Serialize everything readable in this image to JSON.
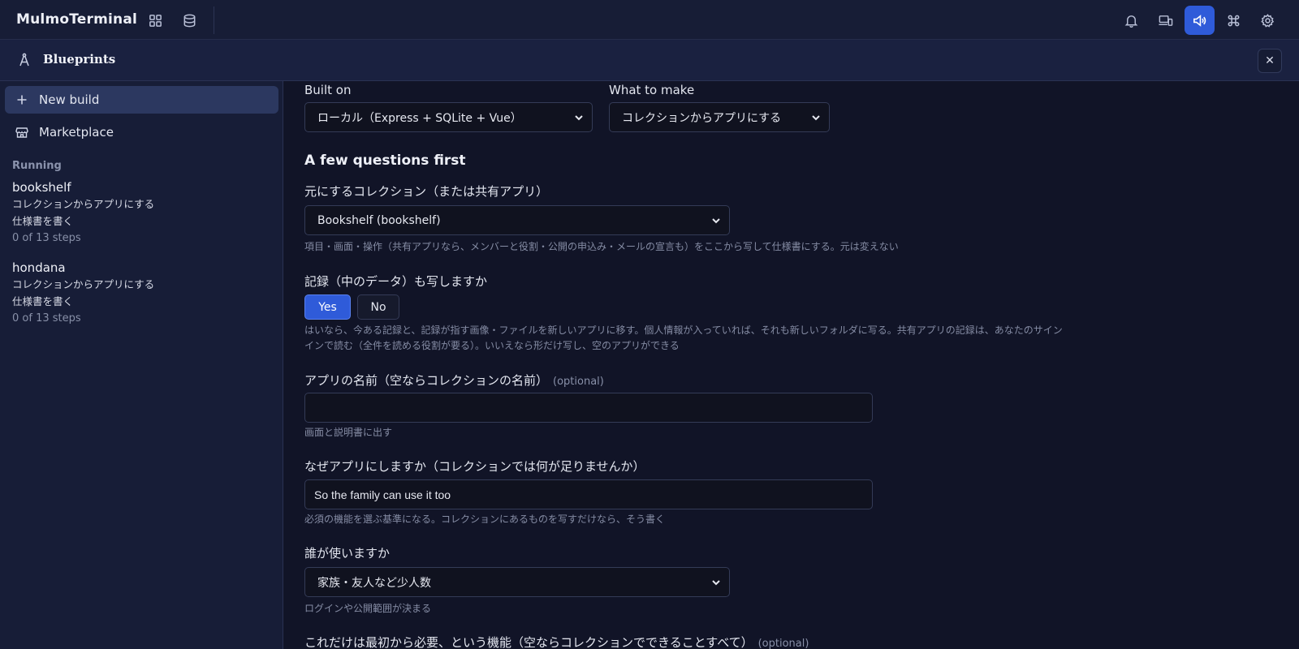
{
  "app": {
    "title": "MulmoTerminal"
  },
  "topbar": {
    "left_icons": [
      "grid-icon",
      "database-icon"
    ],
    "right_icons": [
      "bell-icon",
      "devices-icon",
      "speaker-icon",
      "command-icon",
      "gear-icon"
    ],
    "active_icon": "speaker-icon",
    "accent": "#2f5bd9"
  },
  "subheader": {
    "title": "Blueprints",
    "icon": "compass-icon",
    "close_icon": "close-icon"
  },
  "sidebar": {
    "new_build": "New build",
    "marketplace": "Marketplace",
    "running_label": "Running",
    "running": [
      {
        "name": "bookshelf",
        "kind": "コレクションからアプリにする",
        "step": "仕様書を書く",
        "progress": "0 of 13 steps"
      },
      {
        "name": "hondana",
        "kind": "コレクションからアプリにする",
        "step": "仕様書を書く",
        "progress": "0 of 13 steps"
      }
    ]
  },
  "form": {
    "built_on_label": "Built on",
    "built_on_value": "ローカル（Express + SQLite + Vue）",
    "what_label": "What to make",
    "what_value": "コレクションからアプリにする",
    "questions_heading": "A few questions first",
    "source_label": "元にするコレクション（または共有アプリ）",
    "source_value": "Bookshelf (bookshelf)",
    "source_hint": "項目・画面・操作（共有アプリなら、メンバーと役割・公開の申込み・メールの宣言も）をここから写して仕様書にする。元は変えない",
    "copy_label": "記録（中のデータ）も写しますか",
    "copy_yes": "Yes",
    "copy_no": "No",
    "copy_selected": "Yes",
    "copy_hint": "はいなら、今ある記録と、記録が指す画像・ファイルを新しいアプリに移す。個人情報が入っていれば、それも新しいフォルダに写る。共有アプリの記録は、あなたのサインインで読む（全件を読める役割が要る）。いいえなら形だけ写し、空のアプリができる",
    "name_label": "アプリの名前（空ならコレクションの名前）",
    "optional": "(optional)",
    "name_value": "",
    "name_hint": "画面と説明書に出す",
    "why_label": "なぜアプリにしますか（コレクションでは何が足りませんか）",
    "why_value": "So the family can use it too",
    "why_hint": "必須の機能を選ぶ基準になる。コレクションにあるものを写すだけなら、そう書く",
    "who_label": "誰が使いますか",
    "who_value": "家族・友人など少人数",
    "who_hint": "ログインや公開範囲が決まる",
    "features_label": "これだけは最初から必要、という機能（空ならコレクションでできることすべて）"
  }
}
